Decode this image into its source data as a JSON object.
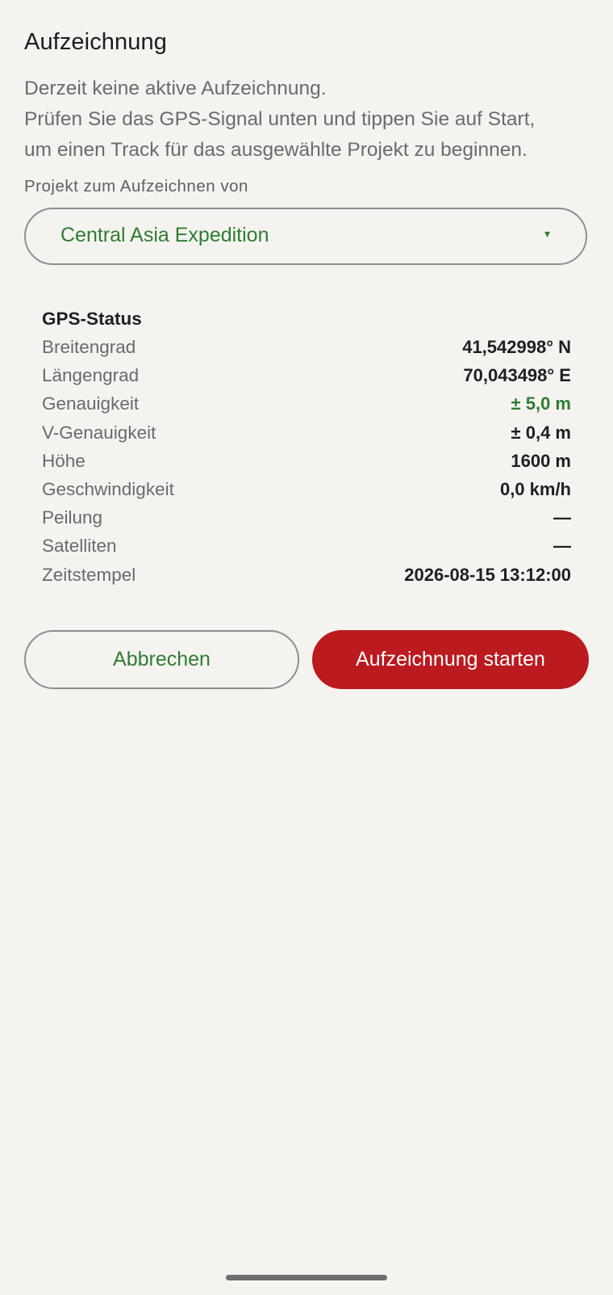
{
  "dialog": {
    "title": "Aufzeichnung",
    "description_lines": [
      "Derzeit keine aktive Aufzeichnung.",
      "Prüfen Sie das GPS-Signal unten und tippen Sie auf Start,",
      "um einen Track für das ausgewählte Projekt zu beginnen."
    ],
    "project_label": "Projekt zum Aufzeichnen von",
    "project_select": {
      "value": "Central Asia Expedition",
      "arrow_glyph": "▾"
    }
  },
  "gps": {
    "title": "GPS-Status",
    "rows": [
      {
        "label": "Breitengrad",
        "value": "41,542998° N"
      },
      {
        "label": "Längengrad",
        "value": "70,043498° E"
      },
      {
        "label": "Genauigkeit",
        "value": "± 5,0 m"
      },
      {
        "label": "V-Genauigkeit",
        "value": "± 0,4 m"
      },
      {
        "label": "Höhe",
        "value": "1600 m"
      },
      {
        "label": "Geschwindigkeit",
        "value": "0,0 km/h"
      },
      {
        "label": "Peilung",
        "value": "—"
      },
      {
        "label": "Satelliten",
        "value": "—"
      },
      {
        "label": "Zeitstempel",
        "value": "2026-08-15 13:12:00"
      }
    ]
  },
  "actions": {
    "cancel_label": "Abbrechen",
    "start_label": "Aufzeichnung starten"
  },
  "colors": {
    "accent_green": "#2e7d32",
    "start_red": "#bb1a1e",
    "background": "#f5f3f0"
  }
}
